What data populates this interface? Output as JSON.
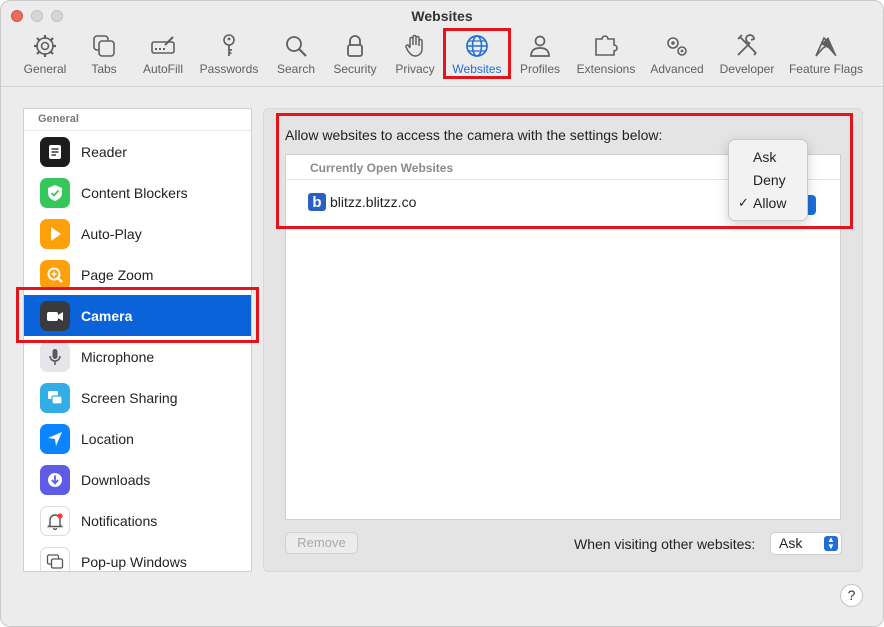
{
  "window": {
    "title": "Websites"
  },
  "toolbar": {
    "items": [
      {
        "label": "General",
        "icon": "gear-icon"
      },
      {
        "label": "Tabs",
        "icon": "tabs-icon"
      },
      {
        "label": "AutoFill",
        "icon": "autofill-icon"
      },
      {
        "label": "Passwords",
        "icon": "key-icon"
      },
      {
        "label": "Search",
        "icon": "search-icon"
      },
      {
        "label": "Security",
        "icon": "lock-icon"
      },
      {
        "label": "Privacy",
        "icon": "hand-icon"
      },
      {
        "label": "Websites",
        "icon": "globe-icon",
        "active": true
      },
      {
        "label": "Profiles",
        "icon": "person-icon"
      },
      {
        "label": "Extensions",
        "icon": "puzzle-icon"
      },
      {
        "label": "Advanced",
        "icon": "gears-icon"
      },
      {
        "label": "Developer",
        "icon": "tools-icon"
      },
      {
        "label": "Feature Flags",
        "icon": "flags-icon"
      }
    ],
    "active_color": "#1e6fd9"
  },
  "sidebar": {
    "header": "General",
    "items": [
      {
        "label": "Reader",
        "icon": "reader-icon",
        "color": "#1c1c1e"
      },
      {
        "label": "Content Blockers",
        "icon": "shield-icon",
        "color": "#34c759"
      },
      {
        "label": "Auto-Play",
        "icon": "play-icon",
        "color": "#ff9f0a"
      },
      {
        "label": "Page Zoom",
        "icon": "zoom-icon",
        "color": "#ff9f0a"
      },
      {
        "label": "Camera",
        "icon": "camera-icon",
        "color": "#3a3a3c",
        "selected": true
      },
      {
        "label": "Microphone",
        "icon": "microphone-icon",
        "color": "#e5e5ea"
      },
      {
        "label": "Screen Sharing",
        "icon": "screen-sharing-icon",
        "color": "#32ade6"
      },
      {
        "label": "Location",
        "icon": "location-icon",
        "color": "#0a84ff"
      },
      {
        "label": "Downloads",
        "icon": "downloads-icon",
        "color": "#5e5ce6"
      },
      {
        "label": "Notifications",
        "icon": "bell-icon",
        "color": "#ffffff"
      },
      {
        "label": "Pop-up Windows",
        "icon": "popup-windows-icon",
        "color": "#ffffff"
      }
    ],
    "selected_color": "#0a63d9"
  },
  "content": {
    "heading": "Allow websites to access the camera with the settings below:",
    "table_header": "Currently Open Websites",
    "site": {
      "name": "blitzz.blitzz.co",
      "favicon_letter": "b"
    },
    "menu": {
      "options": [
        "Ask",
        "Deny",
        "Allow"
      ],
      "selected": "Allow"
    },
    "remove_label": "Remove",
    "other_label": "When visiting other websites:",
    "other_value": "Ask"
  },
  "help": {
    "label": "?"
  },
  "highlight_color": "#e3151a"
}
